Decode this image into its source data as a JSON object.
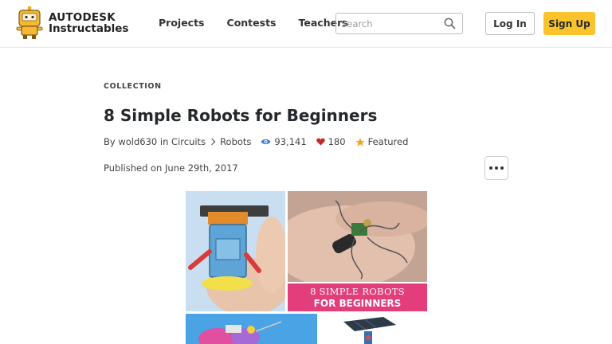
{
  "header": {
    "logo": {
      "brand": "AUTODESK",
      "product": "Instructables",
      "icon": "robot-mascot-icon"
    },
    "nav": [
      {
        "label": "Projects"
      },
      {
        "label": "Contests"
      },
      {
        "label": "Teachers"
      }
    ],
    "search": {
      "placeholder": "Search",
      "icon": "search-icon"
    },
    "login_label": "Log In",
    "signup_label": "Sign Up",
    "colors": {
      "signup": "#fac22b",
      "border": "#bdbdbd"
    }
  },
  "article": {
    "kicker": "COLLECTION",
    "title": "8 Simple Robots for Beginners",
    "meta": {
      "by": "By",
      "author": "wold630",
      "in": "in",
      "category": "Circuits",
      "subcategory": "Robots",
      "views": "93,141",
      "favorites": "180",
      "featured": "Featured",
      "colors": {
        "views_icon": "#3f7fc7",
        "favorites_icon": "#c62828",
        "featured_icon": "#f0a51f"
      }
    },
    "published": "Published on June 29th, 2017",
    "more_icon": "more-horizontal-icon"
  },
  "hero": {
    "banner_line1": "8 SIMPLE ROBOTS",
    "banner_line2": "FOR BEGINNERS",
    "colors": {
      "banner": "#e33d7c"
    }
  }
}
